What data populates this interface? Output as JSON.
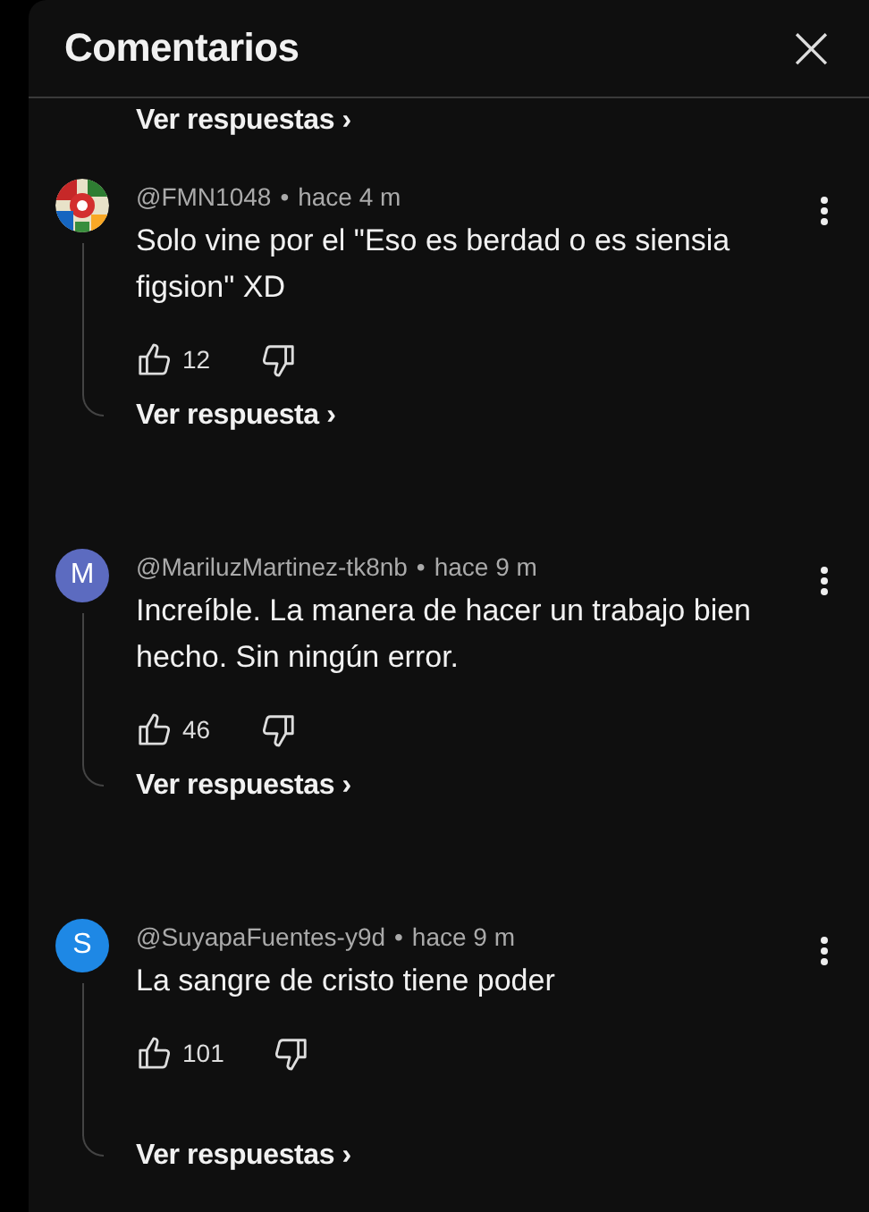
{
  "header": {
    "title": "Comentarios",
    "close": "×"
  },
  "partial_replies": {
    "label": "Ver respuestas",
    "chevron": "›"
  },
  "comments": [
    {
      "author": "@FMN1048",
      "separator": "•",
      "time": "hace 4 m",
      "text": "Solo vine por el \"Eso es berdad o es siensia figsion\" XD",
      "likes": "12",
      "replies": "Ver respuesta",
      "chevron": "›"
    },
    {
      "avatar": {
        "kind": "letter",
        "letter": "M",
        "color": "#5c6bc0"
      },
      "author": "@MariluzMartinez-tk8nb",
      "separator": "•",
      "time": "hace 9 m",
      "text": "Increíble. La manera de hacer un trabajo bien hecho. Sin ningún error.",
      "likes": "46",
      "replies": "Ver respuestas",
      "chevron": "›"
    },
    {
      "avatar": {
        "kind": "letter",
        "letter": "S",
        "color": "#1e88e5"
      },
      "author": "@SuyapaFuentes-y9d",
      "separator": "•",
      "time": "hace 9 m",
      "text": "La sangre de cristo tiene poder",
      "likes": "101",
      "replies": "Ver respuestas",
      "chevron": "›"
    }
  ]
}
